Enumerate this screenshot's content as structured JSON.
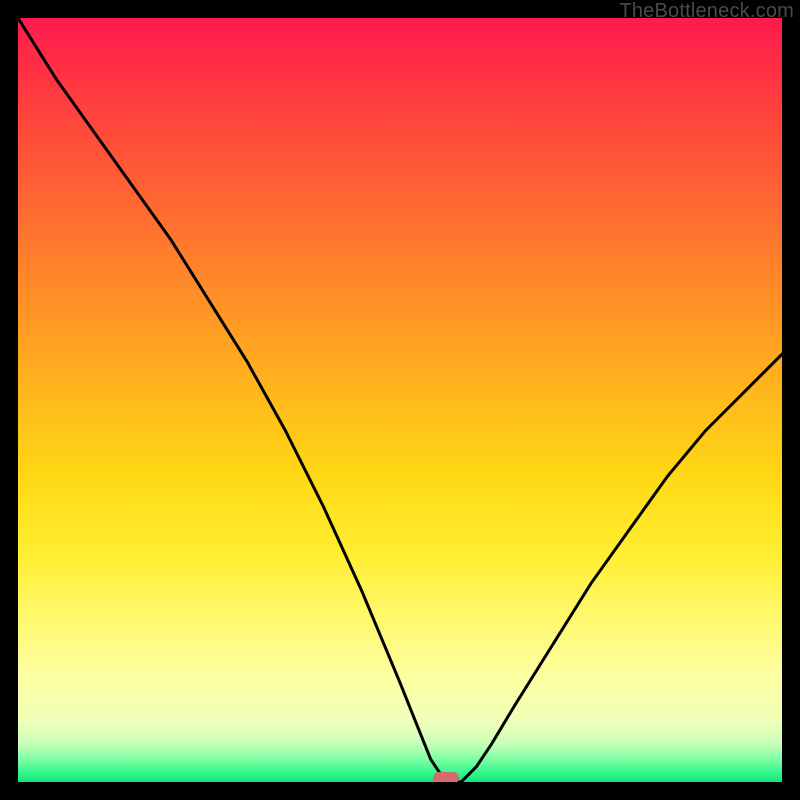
{
  "watermark": "TheBottleneck.com",
  "colors": {
    "frame": "#000000",
    "curve": "#000000",
    "marker": "#d46a6a",
    "gradient_top": "#ff1a4d",
    "gradient_bottom": "#18e07c"
  },
  "chart_data": {
    "type": "line",
    "title": "",
    "xlabel": "",
    "ylabel": "",
    "xlim": [
      0,
      100
    ],
    "ylim": [
      0,
      100
    ],
    "grid": false,
    "legend": false,
    "series": [
      {
        "name": "bottleneck-curve",
        "x": [
          0,
          5,
          10,
          15,
          20,
          25,
          30,
          35,
          40,
          45,
          50,
          52,
          54,
          56,
          58,
          60,
          62,
          65,
          70,
          75,
          80,
          85,
          90,
          95,
          100
        ],
        "values": [
          100,
          92,
          85,
          78,
          71,
          63,
          55,
          46,
          36,
          25,
          13,
          8,
          3,
          0,
          0,
          2,
          5,
          10,
          18,
          26,
          33,
          40,
          46,
          51,
          56
        ]
      }
    ],
    "marker": {
      "x": 56,
      "y": 0
    },
    "background_gradient": {
      "direction": "vertical",
      "stops": [
        {
          "pos": 0.0,
          "color": "#ff1a4d"
        },
        {
          "pos": 0.5,
          "color": "#ffba1c"
        },
        {
          "pos": 0.86,
          "color": "#fdffa0"
        },
        {
          "pos": 1.0,
          "color": "#18e07c"
        }
      ]
    }
  }
}
